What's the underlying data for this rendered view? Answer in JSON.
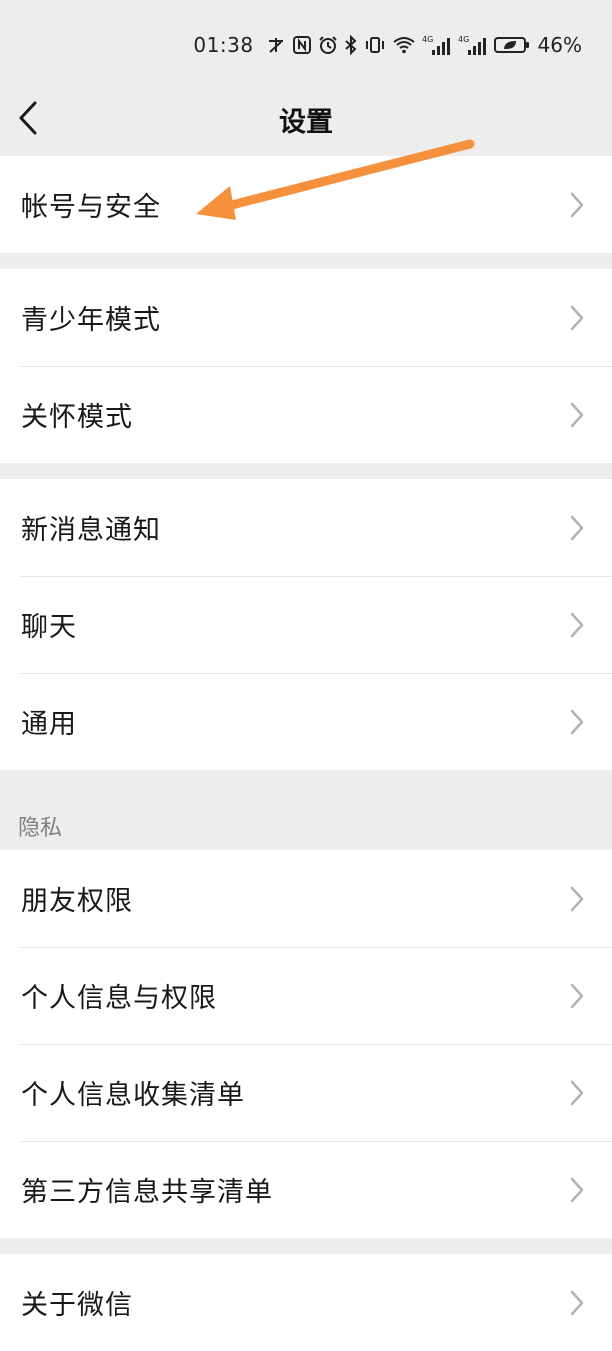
{
  "status_bar": {
    "time": "01:38",
    "battery": "46%",
    "network_4g_1": "4G",
    "network_4g_2": "4G"
  },
  "nav": {
    "title": "设置"
  },
  "groups": [
    {
      "items": [
        {
          "label": "帐号与安全"
        }
      ]
    },
    {
      "items": [
        {
          "label": "青少年模式"
        },
        {
          "label": "关怀模式"
        }
      ]
    },
    {
      "items": [
        {
          "label": "新消息通知"
        },
        {
          "label": "聊天"
        },
        {
          "label": "通用"
        }
      ]
    }
  ],
  "privacy": {
    "header": "隐私",
    "items": [
      {
        "label": "朋友权限"
      },
      {
        "label": "个人信息与权限"
      },
      {
        "label": "个人信息收集清单"
      },
      {
        "label": "第三方信息共享清单"
      }
    ]
  },
  "last_group": {
    "items": [
      {
        "label": "关于微信"
      }
    ]
  },
  "colors": {
    "background": "#ededed",
    "row_background": "#ffffff",
    "annotation_arrow": "#f5903d"
  }
}
